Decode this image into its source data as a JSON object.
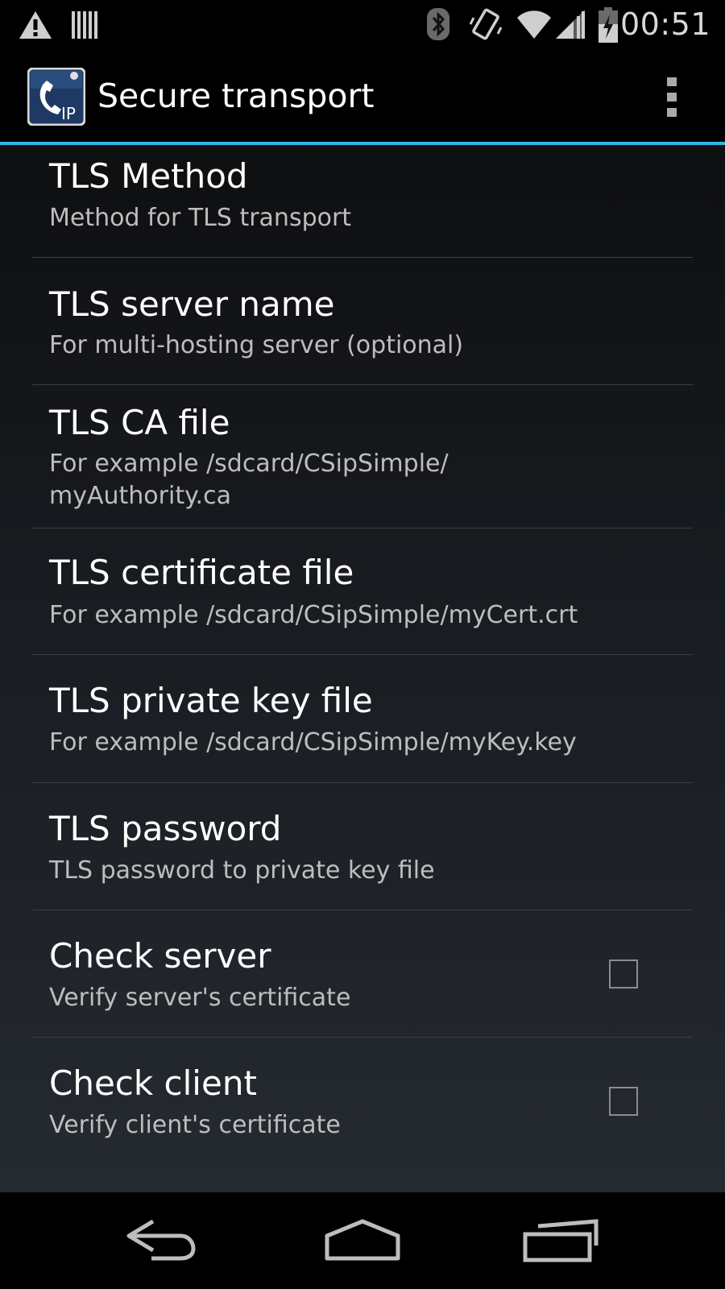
{
  "status_bar": {
    "time": "00:51",
    "icons": [
      "warning-icon",
      "barcode-icon",
      "bluetooth-icon",
      "vibrate-icon",
      "wifi-icon",
      "signal-icon",
      "battery-charging-icon"
    ]
  },
  "action_bar": {
    "title": "Secure transport",
    "app_icon": "csipsimple-app-icon",
    "overflow_icon": "overflow-menu-icon",
    "accent_color": "#33b5e5"
  },
  "preferences": [
    {
      "title": "TLS Method",
      "summary": "Method for TLS transport"
    },
    {
      "title": "TLS server name",
      "summary": "For multi-hosting server (optional)"
    },
    {
      "title": "TLS CA file",
      "summary_line1": "For example /sdcard/CSipSimple/",
      "summary_line2": "myAuthority.ca"
    },
    {
      "title": "TLS certificate file",
      "summary": "For example /sdcard/CSipSimple/myCert.crt"
    },
    {
      "title": "TLS private key file",
      "summary": "For example /sdcard/CSipSimple/myKey.key"
    },
    {
      "title": "TLS password",
      "summary": "TLS password to private key file"
    },
    {
      "title": "Check server",
      "summary": "Verify server's certificate",
      "checked": false
    },
    {
      "title": "Check client",
      "summary": "Verify client's certificate",
      "checked": false
    }
  ],
  "nav_bar": {
    "buttons": [
      "back-icon",
      "home-icon",
      "recent-apps-icon"
    ]
  }
}
